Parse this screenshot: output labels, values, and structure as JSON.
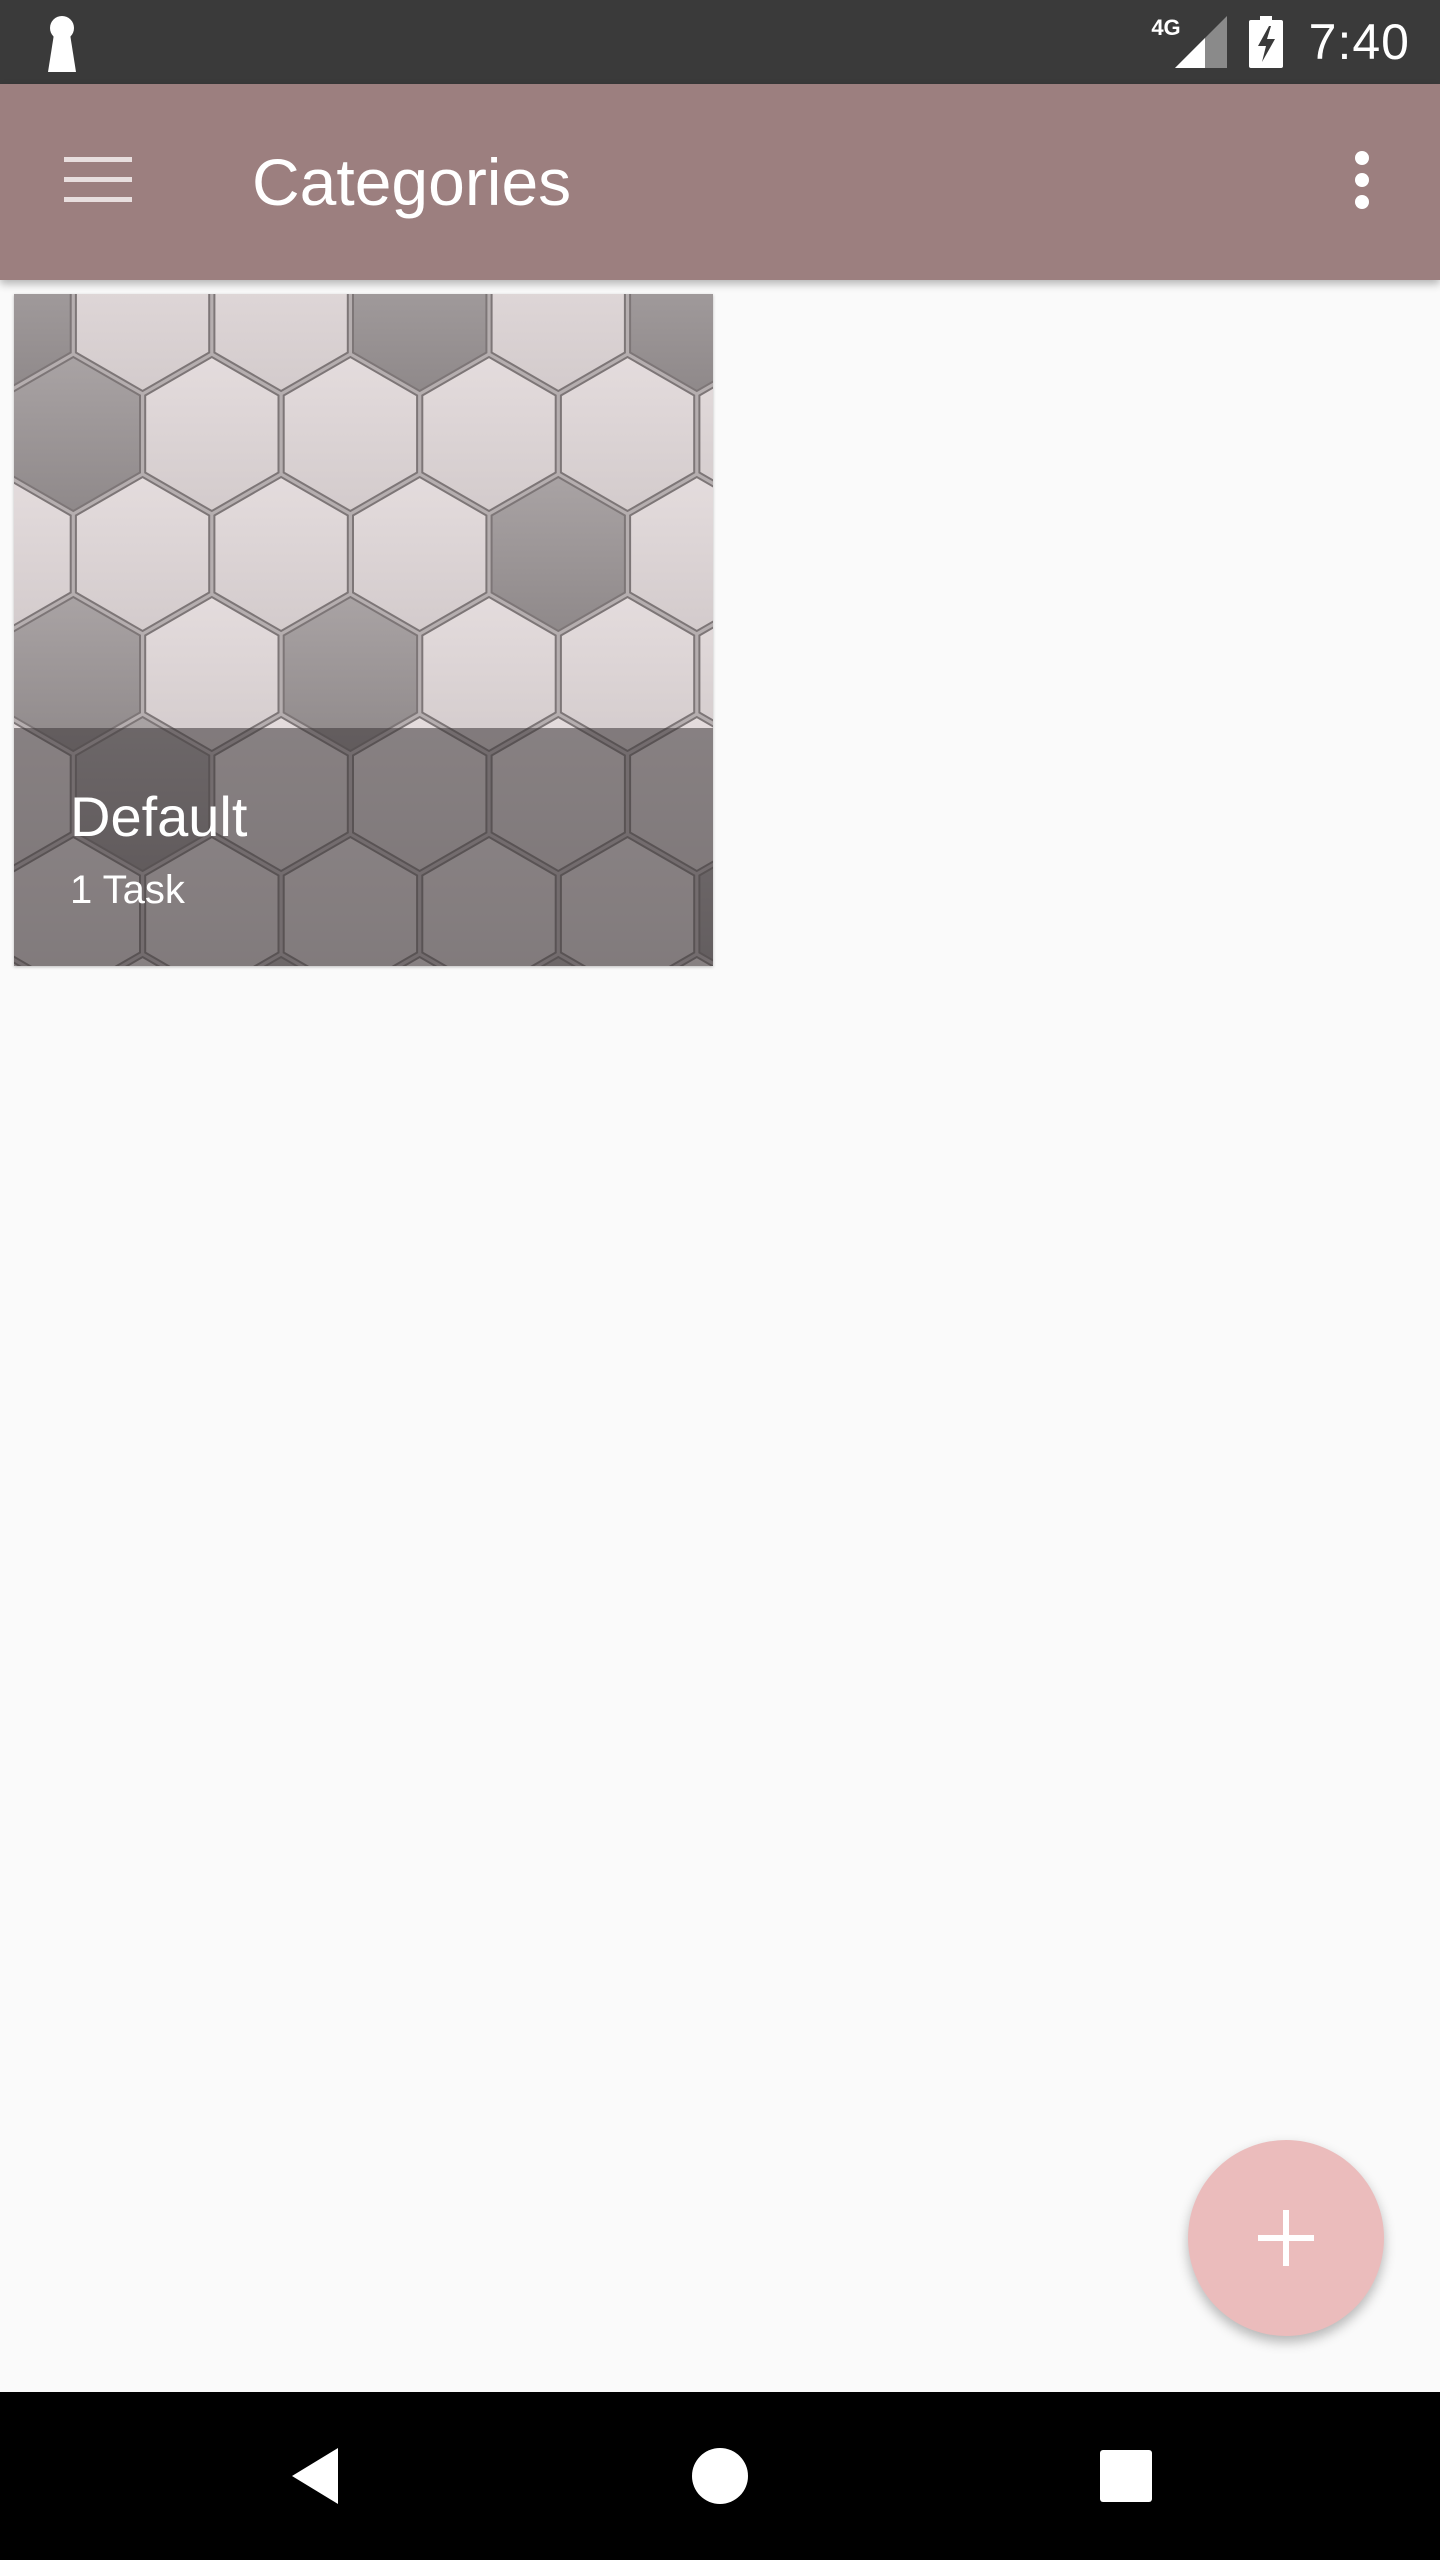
{
  "status_bar": {
    "left_icon": "keyhole-notification-icon",
    "network_type": "4G",
    "signal_icon": "cell-signal-icon",
    "battery_icon": "battery-charging-icon",
    "time": "7:40"
  },
  "app_bar": {
    "menu_icon": "hamburger-menu-icon",
    "title": "Categories",
    "overflow_icon": "more-vertical-icon",
    "color": "#9c7f7f"
  },
  "categories": [
    {
      "name": "Default",
      "task_count": "1 Task",
      "background": "hexagon-pattern-image"
    }
  ],
  "fab": {
    "icon": "plus-icon",
    "color": "#ebbcbc"
  },
  "nav_bar": {
    "back_icon": "back-triangle-icon",
    "home_icon": "home-circle-icon",
    "recents_icon": "recents-square-icon"
  }
}
